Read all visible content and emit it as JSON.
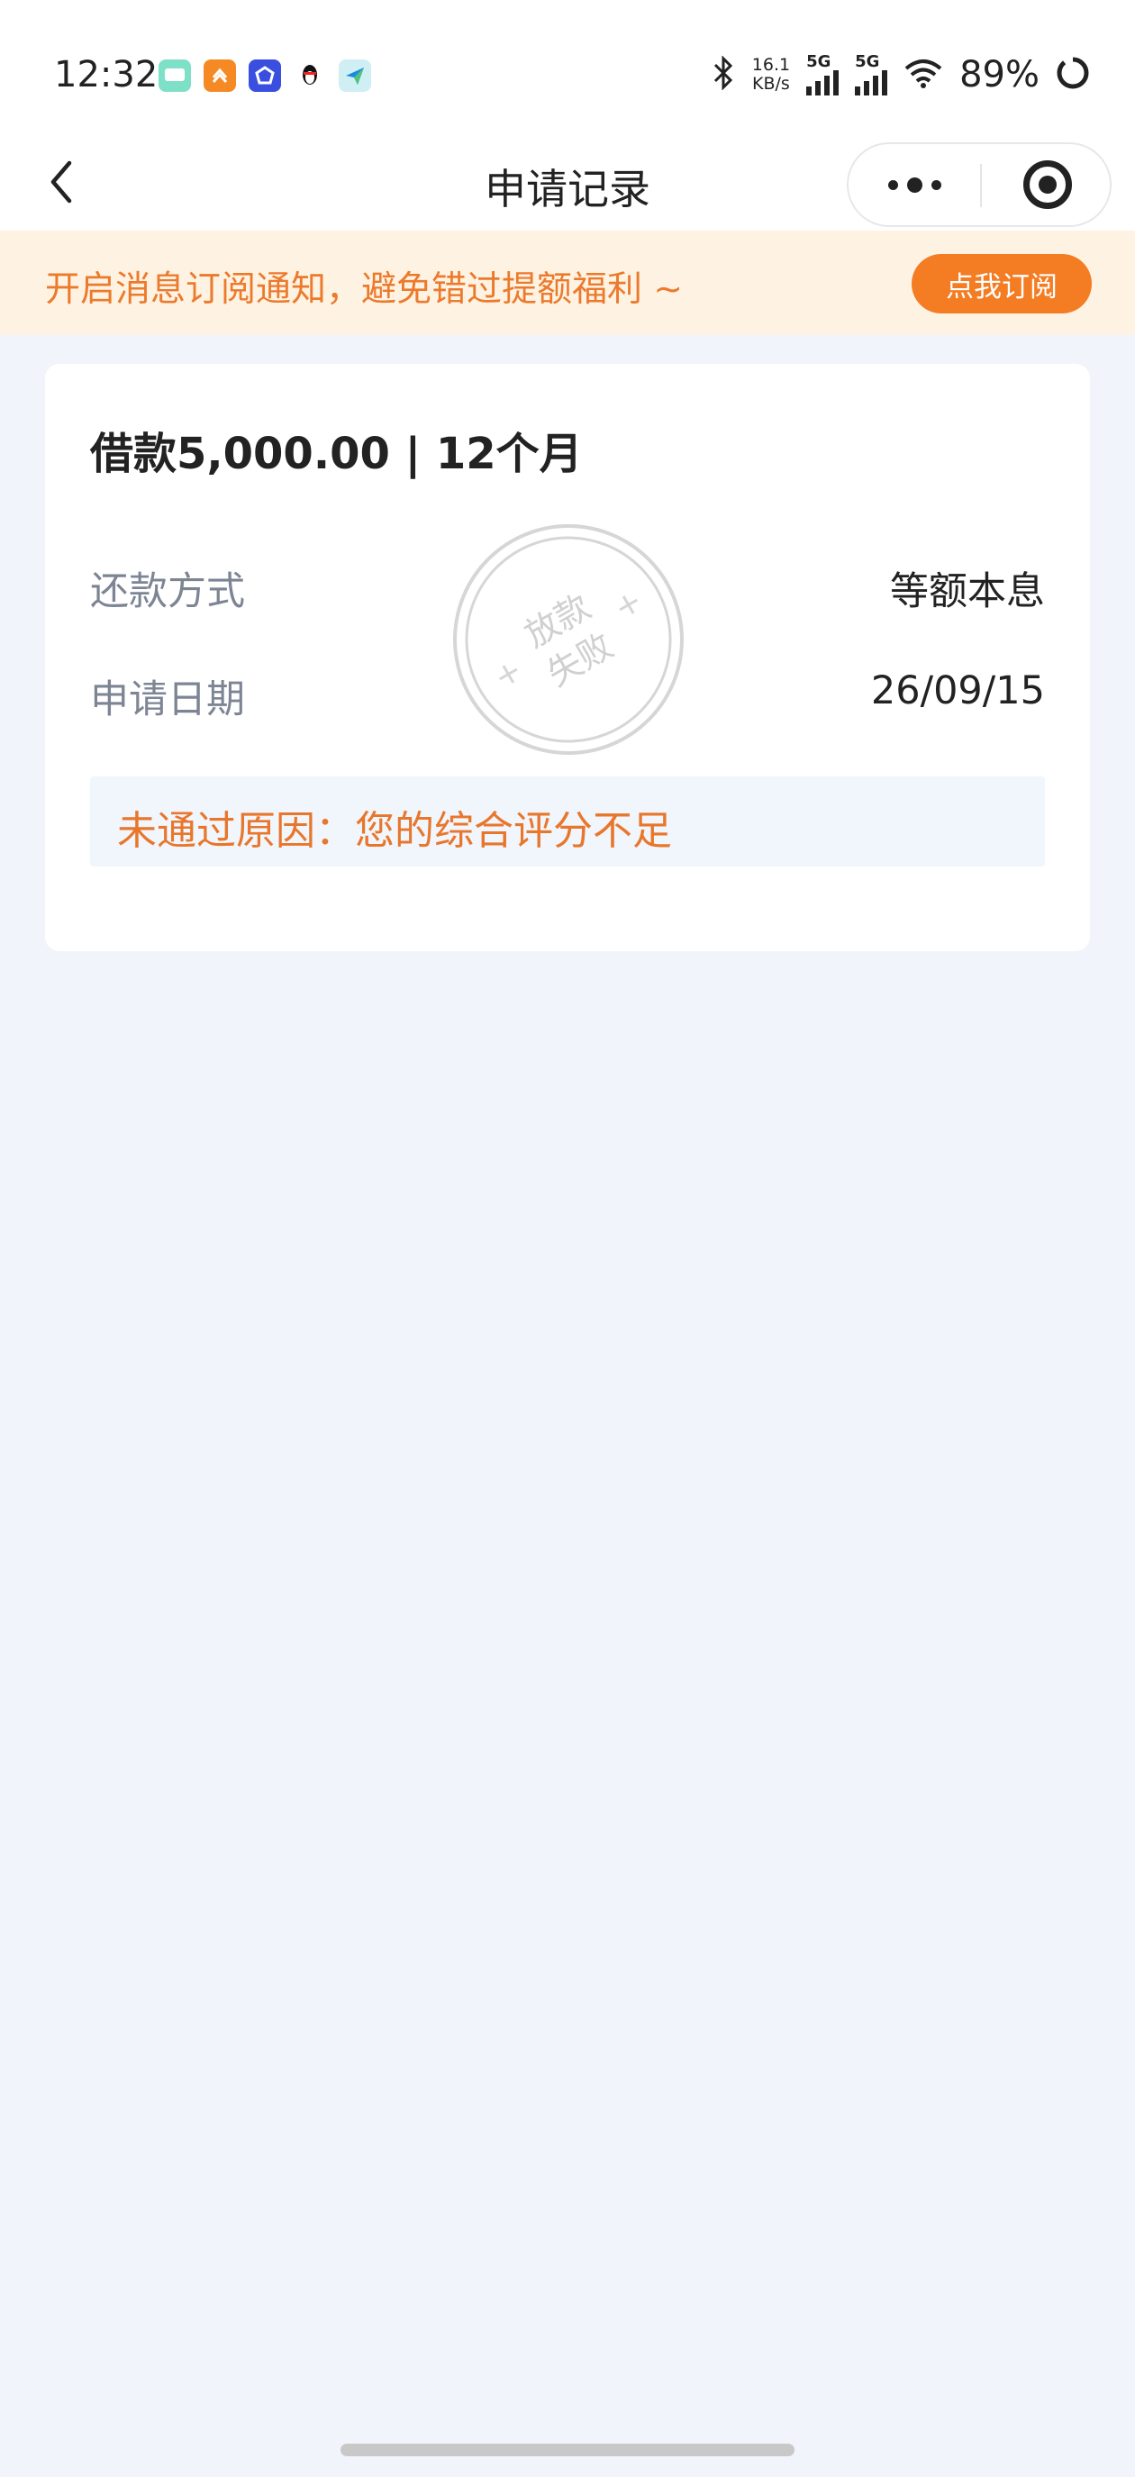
{
  "status_bar": {
    "time": "12:32",
    "net_speed_value": "16.1",
    "net_speed_unit": "KB/s",
    "signal1_label": "5G",
    "signal2_label": "5G",
    "battery_percent": "89%",
    "app_icons": [
      "chat-app-icon",
      "orange-app-icon",
      "blue-app-icon",
      "qq-penguin-icon",
      "paper-plane-app-icon"
    ]
  },
  "nav": {
    "title": "申请记录",
    "back_icon": "chevron-left-icon",
    "more_icon": "more-dots-icon",
    "close_icon": "target-circle-icon"
  },
  "banner": {
    "text": "开启消息订阅通知，避免错过提额福利 ~",
    "button_label": "点我订阅"
  },
  "record": {
    "title": "借款5,000.00 | 12个月",
    "repay_method_label": "还款方式",
    "repay_method_value": "等额本息",
    "apply_date_label": "申请日期",
    "apply_date_value": "26/09/15",
    "reason_text": "未通过原因：您的综合评分不足",
    "stamp_line1": "放款",
    "stamp_line2": "失败"
  },
  "colors": {
    "page_background": "#f1f4fb",
    "accent_orange": "#f47c22",
    "banner_background": "#fef3e2",
    "banner_text": "#ec7a2d",
    "reason_text": "#e8762b",
    "reason_background": "#f1f5fc",
    "label_gray": "#7d8594"
  }
}
